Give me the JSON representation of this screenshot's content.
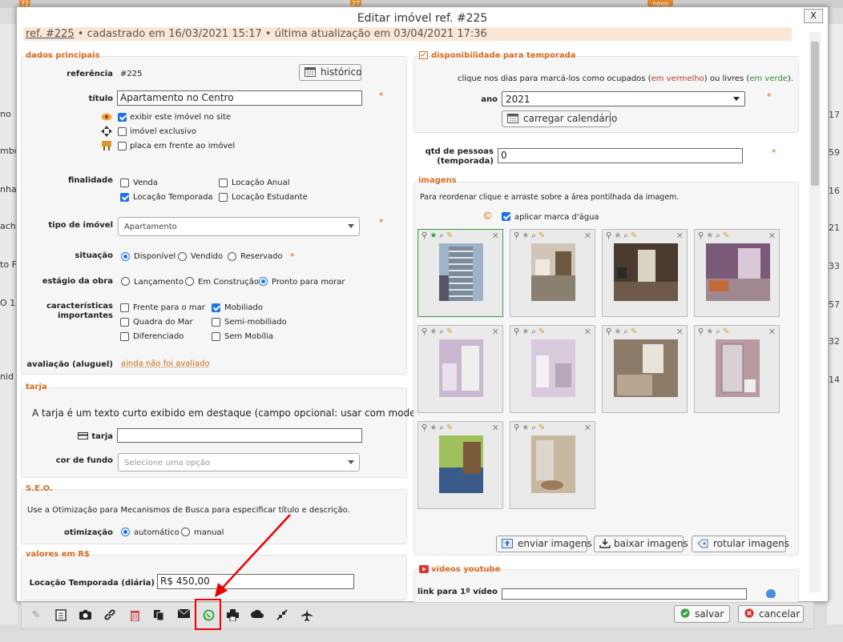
{
  "background": {
    "badges": [
      "72",
      "27",
      "novo"
    ],
    "left_rows": [
      "no",
      "mbo",
      "nha",
      "ach",
      "to F",
      "O 1",
      "nid"
    ],
    "right_numbers": [
      "17",
      "59",
      "16",
      "21",
      "33",
      "57",
      "32",
      "14"
    ]
  },
  "dialog": {
    "title": "Editar imóvel ref. #225",
    "close": "X",
    "subheader": {
      "ref_label": "ref. #225",
      "info": " • cadastrado em 16/03/2021 15:17 • última atualização em 03/04/2021 17:36"
    }
  },
  "dados_principais": {
    "section_title": "dados principais",
    "referencia_label": "referência",
    "referencia_value": "#225",
    "historico_button": "histórico",
    "titulo_label": "título",
    "titulo_value": "Apartamento no Centro",
    "check_exibir": "exibir este imóvel no site",
    "check_exclusivo": "imóvel exclusivo",
    "check_placa": "placa em frente ao imóvel",
    "finalidade_label": "finalidade",
    "finalidade": {
      "venda": "Venda",
      "locacao_anual": "Locação Anual",
      "locacao_temporada": "Locação Temporada",
      "locacao_estudante": "Locação Estudante"
    },
    "tipo_label": "tipo de imóvel",
    "tipo_value": "Apartamento",
    "situacao_label": "situação",
    "situacao": {
      "disponivel": "Disponível",
      "vendido": "Vendido",
      "reservado": "Reservado"
    },
    "estagio_label": "estágio da obra",
    "estagio": {
      "lancamento": "Lançamento",
      "construcao": "Em Construção",
      "pronto": "Pronto para morar"
    },
    "caracteristicas_label1": "características",
    "caracteristicas_label2": "importantes",
    "caracteristicas": {
      "frente_mar": "Frente para o mar",
      "quadra_mar": "Quadra do Mar",
      "diferenciado": "Diferenciado",
      "mobiliado": "Mobiliado",
      "semi": "Semi-mobiliado",
      "sem": "Sem Mobília"
    },
    "avaliacao_label": "avaliação (aluguel)",
    "avaliacao_link": "ainda não foi avaliado"
  },
  "tarja": {
    "section_title": "tarja",
    "description": "A tarja é um texto curto exibido em destaque (campo opcional: usar com moderação)",
    "tarja_label": "tarja",
    "cor_label": "cor de fundo",
    "cor_placeholder": "Selecione uma opção"
  },
  "seo": {
    "section_title": "S.E.O.",
    "description": "Use a Otimização para Mecanismos de Busca para especificar título e descrição.",
    "otimizacao_label": "otimização",
    "automatico": "automático",
    "manual": "manual"
  },
  "valores": {
    "section_title": "valores em R$",
    "temporada_label": "Locação Temporada (diária)",
    "temporada_value": "R$ 450,00"
  },
  "disponibilidade": {
    "section_title": "disponibilidade para temporada",
    "instr_a": "clique nos dias para marcá-los como ocupados (",
    "instr_red": "em vermelho",
    "instr_b": ") ou livres (",
    "instr_green": "em verde",
    "instr_c": ").",
    "ano_label": "ano",
    "ano_value": "2021",
    "carregar_button": "carregar calendário"
  },
  "pessoas": {
    "label1": "qtd de pessoas",
    "label2": "(temporada)",
    "value": "0"
  },
  "imagens": {
    "section_title": "imagens",
    "instr": "Para reordenar clique e arraste sobre a área pontilhada da imagem.",
    "marca_dagua": "aplicar marca d'água",
    "thumb_tools": "⚲★⌕✎",
    "enviar_button": "enviar imagens",
    "baixar_button": "baixar imagens",
    "rotular_button": "rotular imagens"
  },
  "videos": {
    "section_title": "vídeos youtube",
    "link_label": "link para 1º vídeo"
  },
  "toolbar": {
    "salvar": "salvar",
    "cancelar": "cancelar"
  },
  "colors": {
    "accent": "#d96a1d",
    "checkbox": "#1a73e8",
    "highlight": "#e00000",
    "whatsapp": "#25a244"
  }
}
